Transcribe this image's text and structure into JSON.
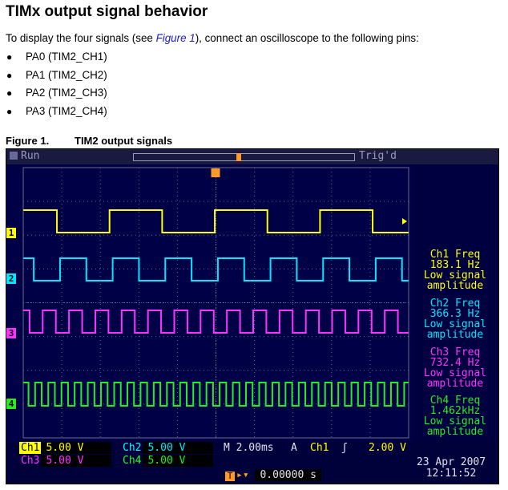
{
  "heading": "TIMx output signal behavior",
  "intro": {
    "before": "To display the four signals (see ",
    "link": "Figure 1",
    "after": "), connect an oscilloscope to the following pins:"
  },
  "pins": [
    "PA0 (TIM2_CH1)",
    "PA1 (TIM2_CH2)",
    "PA2 (TIM2_CH3)",
    "PA3 (TIM2_CH4)"
  ],
  "figure": {
    "number": "Figure 1.",
    "caption": "TIM2 output signals"
  },
  "scope": {
    "status": "Run",
    "trigger_status": "Trig'd",
    "colors": {
      "ch1": "#ffff00",
      "ch2": "#00e8ff",
      "ch3": "#ff33ff",
      "ch4": "#22ee22",
      "background": "#000046",
      "grid": "#6a6a8a"
    },
    "channel_markers": [
      "1",
      "2",
      "3",
      "4"
    ],
    "measurements": [
      {
        "label": "Ch1 Freq",
        "value": "183.1 Hz",
        "note1": "Low signal",
        "note2": "amplitude"
      },
      {
        "label": "Ch2 Freq",
        "value": "366.3 Hz",
        "note1": "Low signal",
        "note2": "amplitude"
      },
      {
        "label": "Ch3 Freq",
        "value": "732.4 Hz",
        "note1": "Low signal",
        "note2": "amplitude"
      },
      {
        "label": "Ch4 Freq",
        "value": "1.462kHz",
        "note1": "Low signal",
        "note2": "amplitude"
      }
    ],
    "settings": {
      "ch1_label": "Ch1",
      "ch1_scale": "5.00 V",
      "ch2_label": "Ch2",
      "ch2_scale": "5.00 V",
      "ch3_label": "Ch3",
      "ch3_scale": "5.00 V",
      "ch4_label": "Ch4",
      "ch4_scale": "5.00 V",
      "timebase": "M 2.00ms",
      "trigger_mode": "A",
      "trigger_source": "Ch1",
      "trigger_slope": "ʃ",
      "trigger_level": "2.00 V",
      "trigger_position": "0.00000 s"
    },
    "date": "23 Apr 2007",
    "time": "12:11:52",
    "signals": [
      {
        "channel": "ch1",
        "frequency_hz": 183.1
      },
      {
        "channel": "ch2",
        "frequency_hz": 366.3
      },
      {
        "channel": "ch3",
        "frequency_hz": 732.4
      },
      {
        "channel": "ch4",
        "frequency_hz": 1462
      }
    ]
  }
}
